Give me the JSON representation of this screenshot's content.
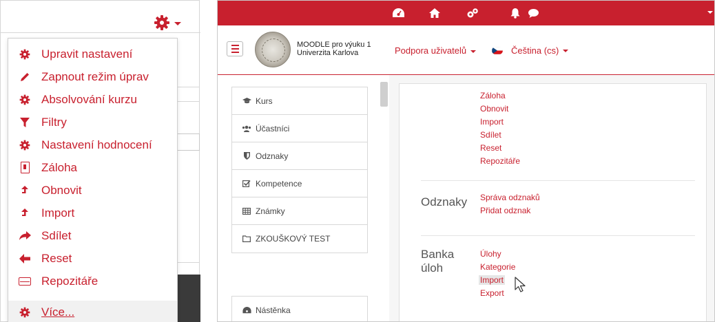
{
  "left_menu": {
    "items": [
      {
        "label": "Upravit nastavení",
        "icon": "gear-icon"
      },
      {
        "label": "Zapnout režim úprav",
        "icon": "pencil-icon"
      },
      {
        "label": "Absolvování kurzu",
        "icon": "gear-icon"
      },
      {
        "label": "Filtry",
        "icon": "filter-icon"
      },
      {
        "label": "Nastavení hodnocení",
        "icon": "gear-icon"
      },
      {
        "label": "Záloha",
        "icon": "backup-file-icon"
      },
      {
        "label": "Obnovit",
        "icon": "upload-arrow-icon"
      },
      {
        "label": "Import",
        "icon": "upload-arrow-icon"
      },
      {
        "label": "Sdílet",
        "icon": "share-arrow-icon"
      },
      {
        "label": "Reset",
        "icon": "arrow-left-icon"
      },
      {
        "label": "Repozitáře",
        "icon": "drive-icon"
      },
      {
        "label": "Více...",
        "icon": "gear-icon"
      }
    ]
  },
  "header": {
    "site_line1": "MOODLE pro výuku 1",
    "site_line2": "Univerzita Karlova",
    "support_label": "Podpora uživatelů",
    "language_label": "Čeština (cs)"
  },
  "nav": {
    "items": [
      {
        "label": "Kurs",
        "icon": "graduation-cap-icon"
      },
      {
        "label": "Účastníci",
        "icon": "users-icon"
      },
      {
        "label": "Odznaky",
        "icon": "shield-icon"
      },
      {
        "label": "Kompetence",
        "icon": "checkbox-icon"
      },
      {
        "label": "Známky",
        "icon": "table-icon"
      },
      {
        "label": "ZKOUŠKOVÝ TEST",
        "icon": "folder-icon"
      }
    ],
    "dashboard_label": "Nástěnka"
  },
  "content": {
    "course_links": [
      "Záloha",
      "Obnovit",
      "Import",
      "Sdílet",
      "Reset",
      "Repozitáře"
    ],
    "badges_title": "Odznaky",
    "badges_links": [
      "Správa odznaků",
      "Přidat odznak"
    ],
    "qbank_title_line1": "Banka",
    "qbank_title_line2": "úloh",
    "qbank_links": [
      "Úlohy",
      "Kategorie",
      "Import",
      "Export"
    ]
  },
  "colors": {
    "accent": "#c8202e",
    "text": "#333333"
  }
}
